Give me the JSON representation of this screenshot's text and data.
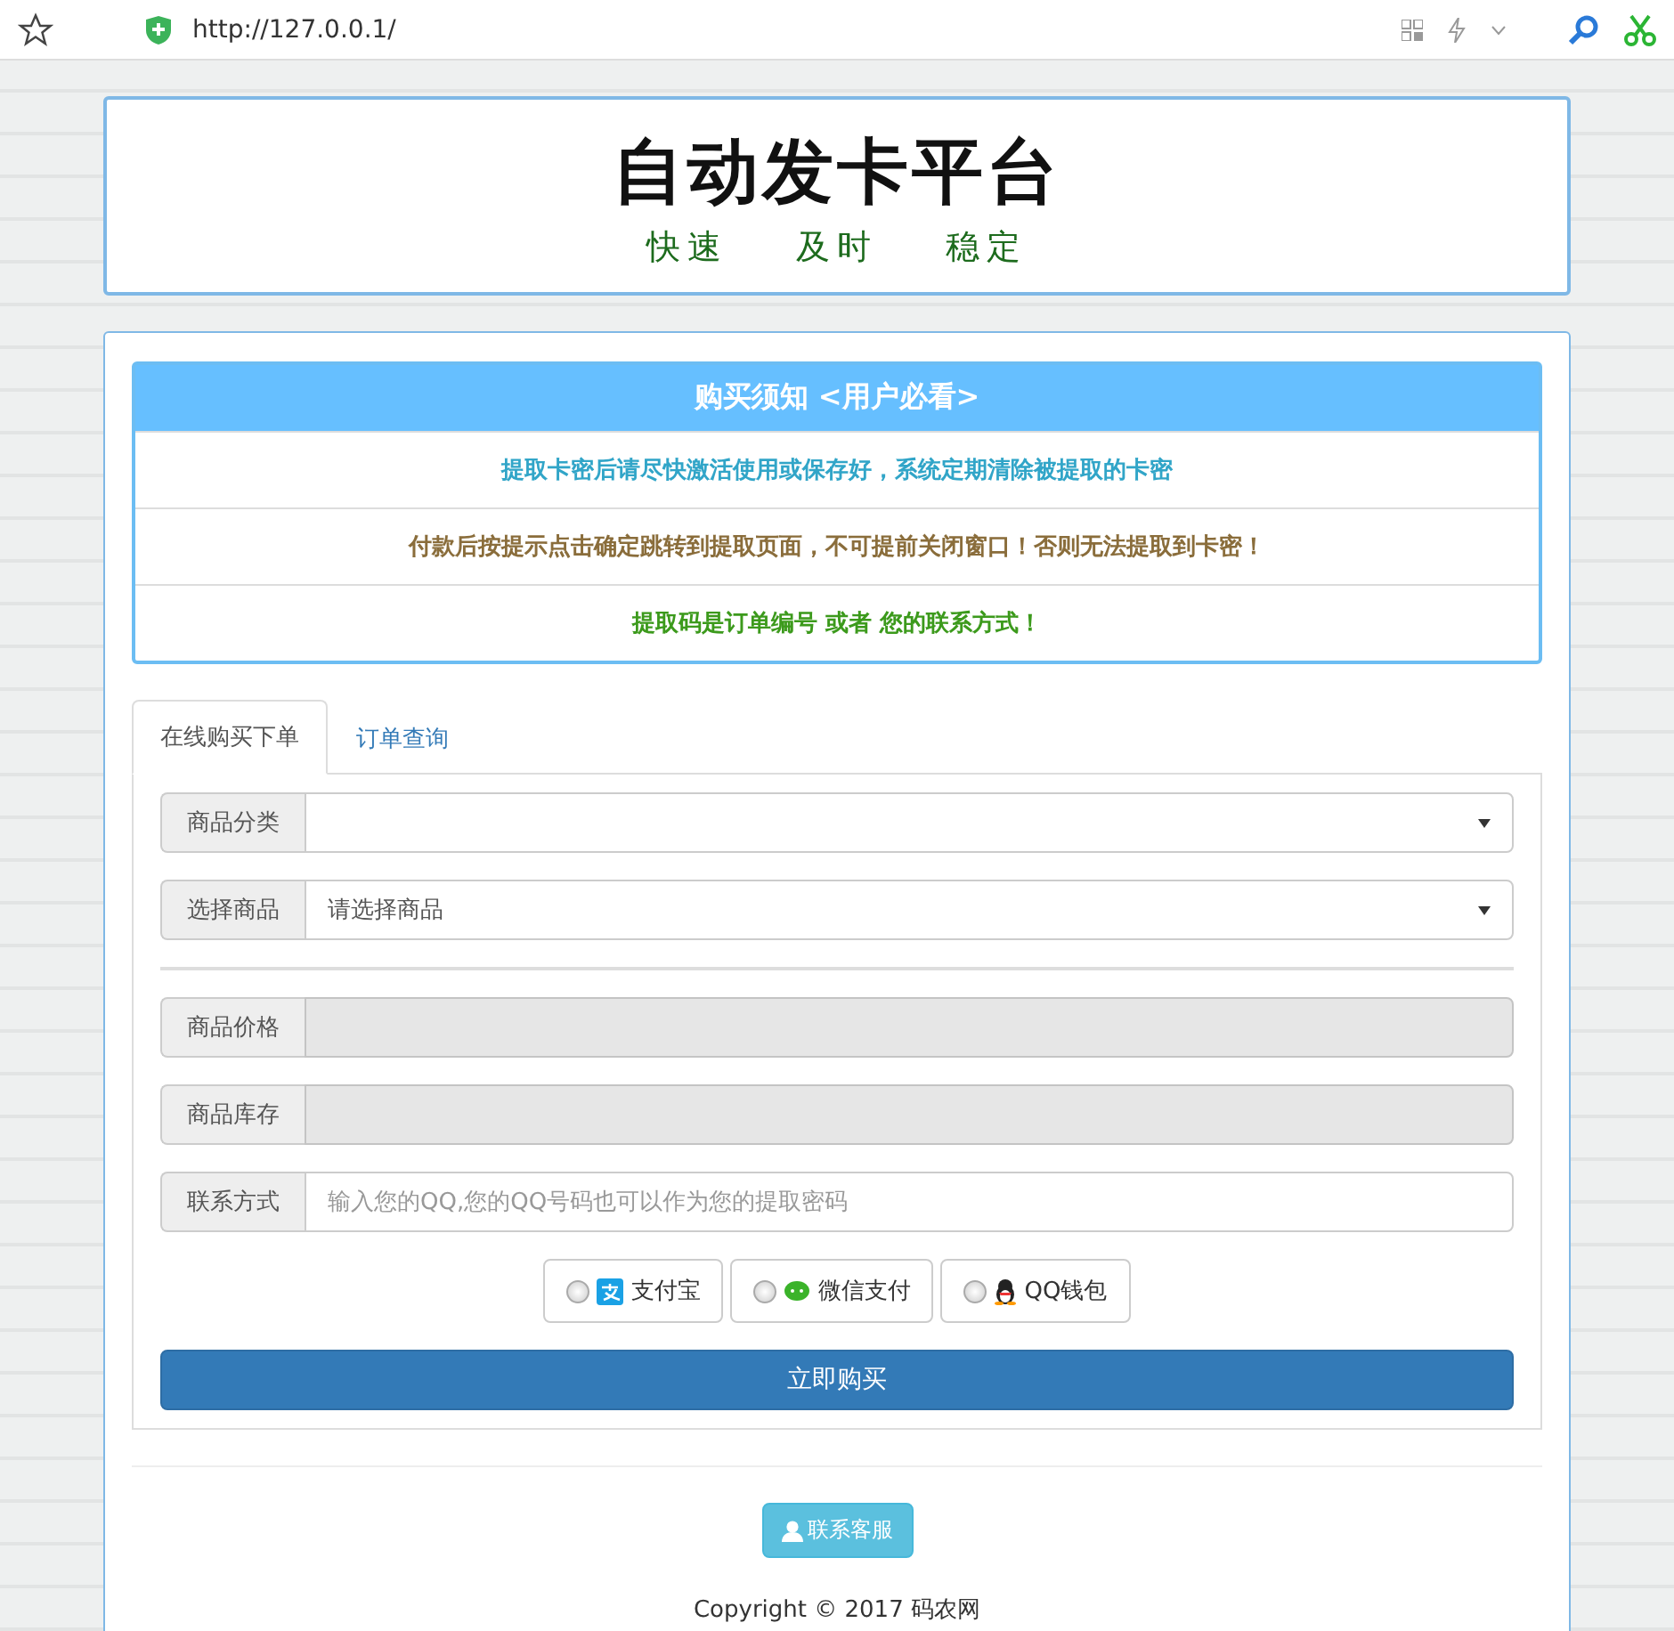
{
  "browser": {
    "url": "http://127.0.0.1/"
  },
  "header": {
    "title": "自动发卡平台",
    "slogans": [
      "快速",
      "及时",
      "稳定"
    ]
  },
  "notice": {
    "title": "购买须知 <用户必看>",
    "lines": [
      {
        "text": "提取卡密后请尽快激活使用或保存好，系统定期清除被提取的卡密",
        "color": "#31a5c8"
      },
      {
        "text": "付款后按提示点击确定跳转到提取页面，不可提前关闭窗口！否则无法提取到卡密！",
        "color": "#8a6d3b"
      },
      {
        "text": "提取码是订单编号 或者 您的联系方式！",
        "color": "#3c9a1c"
      }
    ]
  },
  "tabs": [
    {
      "label": "在线购买下单",
      "selected": true
    },
    {
      "label": "订单查询",
      "selected": false
    }
  ],
  "fields": [
    {
      "label": "商品分类",
      "kind": "select",
      "disabled": false
    },
    {
      "label": "选择商品",
      "kind": "select",
      "value": "请选择商品",
      "disabled": false
    },
    {
      "kind": "divider"
    },
    {
      "label": "商品价格",
      "kind": "input",
      "disabled": true
    },
    {
      "label": "商品库存",
      "kind": "input",
      "disabled": true
    },
    {
      "label": "联系方式",
      "kind": "input",
      "placeholder": "输入您的QQ,您的QQ号码也可以作为您的提取密码",
      "disabled": false
    }
  ],
  "payments": [
    {
      "label": "支付宝",
      "kind": "alipay",
      "selected": false
    },
    {
      "label": "微信支付",
      "kind": "wechat",
      "selected": false
    },
    {
      "label": "QQ钱包",
      "kind": "qq",
      "selected": false
    }
  ],
  "buy_button": "立即购买",
  "contact_button": "联系客服",
  "copyright": "Copyright © 2017 码农网"
}
